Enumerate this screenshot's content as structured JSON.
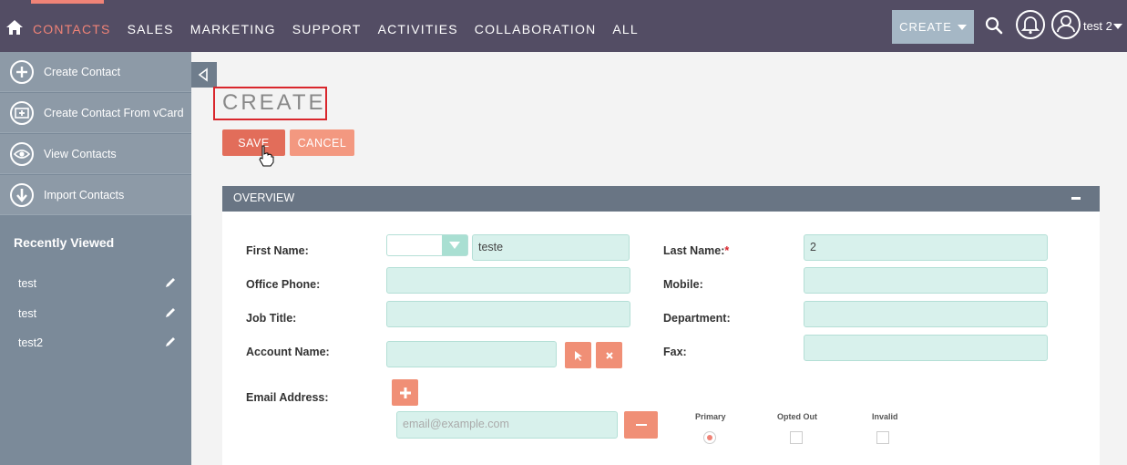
{
  "nav": {
    "items": [
      "CONTACTS",
      "SALES",
      "MARKETING",
      "SUPPORT",
      "ACTIVITIES",
      "COLLABORATION",
      "ALL"
    ],
    "active_index": 0,
    "create_label": "CREATE",
    "user_name": "test 2"
  },
  "sidebar": {
    "actions": [
      {
        "label": "Create Contact",
        "icon": "plus-circle-icon"
      },
      {
        "label": "Create Contact From vCard",
        "icon": "vcard-icon"
      },
      {
        "label": "View Contacts",
        "icon": "eye-icon"
      },
      {
        "label": "Import Contacts",
        "icon": "download-arrow-icon"
      }
    ],
    "recently_viewed_title": "Recently Viewed",
    "recently_viewed": [
      "test",
      "test",
      "test2"
    ]
  },
  "page": {
    "title": "CREATE",
    "save_label": "SAVE",
    "cancel_label": "CANCEL"
  },
  "panel": {
    "title": "OVERVIEW"
  },
  "form": {
    "first_name_label": "First Name:",
    "first_name_value": "teste",
    "salutation_value": "",
    "last_name_label": "Last Name:",
    "last_name_required_mark": "*",
    "last_name_value": "2",
    "office_phone_label": "Office Phone:",
    "office_phone_value": "",
    "mobile_label": "Mobile:",
    "mobile_value": "",
    "job_title_label": "Job Title:",
    "job_title_value": "",
    "department_label": "Department:",
    "department_value": "",
    "account_name_label": "Account Name:",
    "account_name_value": "",
    "fax_label": "Fax:",
    "fax_value": "",
    "email_label": "Email Address:",
    "email_placeholder": "email@example.com",
    "email_columns": {
      "primary": "Primary",
      "opted_out": "Opted Out",
      "invalid": "Invalid"
    },
    "email_primary_checked": true,
    "email_opted_out_checked": false,
    "email_invalid_checked": false
  },
  "colors": {
    "nav_bg": "#534d64",
    "accent": "#f08377",
    "sidebar_bg": "#7b8a99",
    "input_bg": "#d8f1ec",
    "save_btn": "#e26d5a",
    "highlight": "#d9262c"
  }
}
